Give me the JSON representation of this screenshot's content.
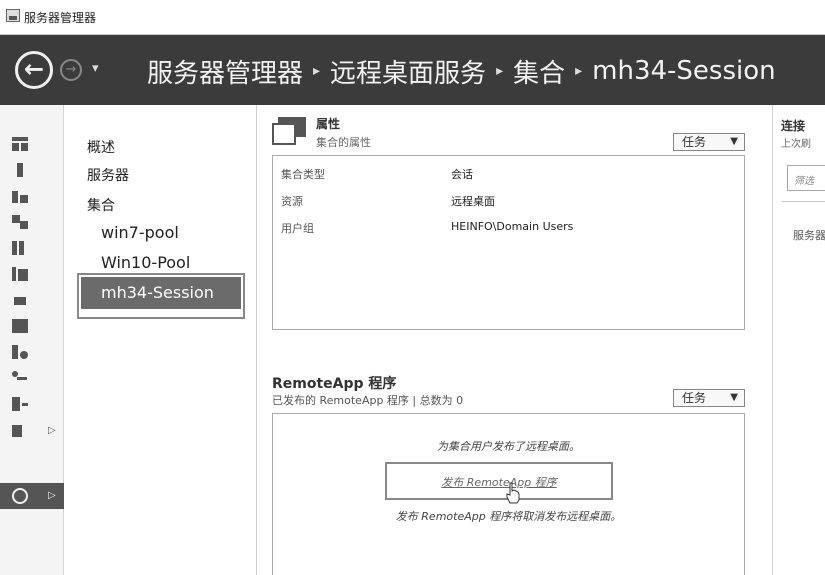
{
  "window": {
    "title": "服务器管理器"
  },
  "header": {
    "breadcrumb": [
      "服务器管理器",
      "远程桌面服务",
      "集合",
      "mh34-Session"
    ]
  },
  "nav": {
    "items": [
      "概述",
      "服务器",
      "集合"
    ],
    "collections": [
      "win7-pool",
      "Win10-Pool",
      "mh34-Session"
    ],
    "selected": "mh34-Session"
  },
  "properties": {
    "title": "属性",
    "subtitle": "集合的属性",
    "task_label": "任务",
    "rows": [
      {
        "label": "集合类型",
        "value": "会话"
      },
      {
        "label": "资源",
        "value": "远程桌面"
      },
      {
        "label": "用户组",
        "value": "HEINFO\\Domain Users"
      }
    ]
  },
  "remoteapp": {
    "title": "RemoteApp 程序",
    "subtitle": "已发布的 RemoteApp 程序 | 总数为 0",
    "task_label": "任务",
    "message_top": "为集合用户发布了远程桌面。",
    "publish_link": "发布 RemoteApp 程序",
    "message_bottom": "发布 RemoteApp 程序将取消发布远程桌面。"
  },
  "connections": {
    "title": "连接",
    "subtitle": "上次刷",
    "filter_placeholder": "筛选",
    "server_col": "服务器"
  },
  "icons": {
    "back": "back-arrow-icon",
    "forward": "forward-arrow-icon",
    "accent": "#3b3b3b"
  }
}
